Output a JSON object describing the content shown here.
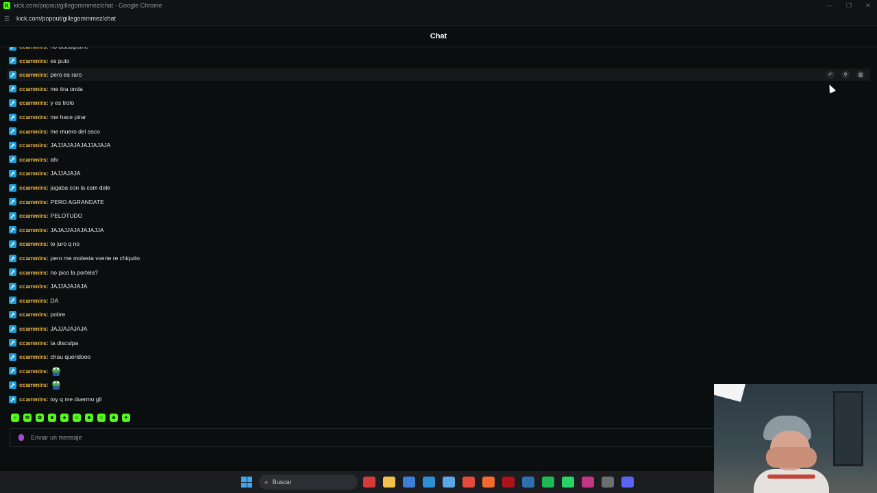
{
  "window": {
    "title": "kick.com/popout/gillegommmez/chat - Google Chrome",
    "url": "kick.com/popout/gillegommmez/chat",
    "controls": [
      "minimize",
      "restore",
      "close"
    ]
  },
  "chat": {
    "header": "Chat",
    "messages": [
      {
        "user": "ccammirs",
        "text": "no disculpame",
        "emote": false
      },
      {
        "user": "ccammirs",
        "text": "es puto",
        "emote": false
      },
      {
        "user": "ccammirs",
        "text": "pero es raro",
        "emote": false
      },
      {
        "user": "ccammirs",
        "text": "me tira onda",
        "emote": false
      },
      {
        "user": "ccammirs",
        "text": "y es trolo",
        "emote": false
      },
      {
        "user": "ccammirs",
        "text": "me hace pirar",
        "emote": false
      },
      {
        "user": "ccammirs",
        "text": "me muero del asco",
        "emote": false
      },
      {
        "user": "ccammirs",
        "text": "JAJJAJAJAJAJJAJAJA",
        "emote": false
      },
      {
        "user": "ccammirs",
        "text": "ahi",
        "emote": false
      },
      {
        "user": "ccammirs",
        "text": "JAJJAJAJA",
        "emote": false
      },
      {
        "user": "ccammirs",
        "text": "jugaba con la cam dale",
        "emote": false
      },
      {
        "user": "ccammirs",
        "text": "PERO AGRANDATE",
        "emote": false
      },
      {
        "user": "ccammirs",
        "text": "PELOTUDO",
        "emote": false
      },
      {
        "user": "ccammirs",
        "text": "JAJAJJAJAJAJAJJA",
        "emote": false
      },
      {
        "user": "ccammirs",
        "text": "te juro q no",
        "emote": false
      },
      {
        "user": "ccammirs",
        "text": "pero me molesta vverte re chiquito",
        "emote": false
      },
      {
        "user": "ccammirs",
        "text": "no pico la portela?",
        "emote": false
      },
      {
        "user": "ccammirs",
        "text": "JAJJAJAJAJA",
        "emote": false
      },
      {
        "user": "ccammirs",
        "text": "DA",
        "emote": false
      },
      {
        "user": "ccammirs",
        "text": "pobre",
        "emote": false
      },
      {
        "user": "ccammirs",
        "text": "JAJJAJAJAJA",
        "emote": false
      },
      {
        "user": "ccammirs",
        "text": "ta disculpa",
        "emote": false
      },
      {
        "user": "ccammirs",
        "text": "chau queridooo",
        "emote": false
      },
      {
        "user": "ccammirs",
        "text": "",
        "emote": true
      },
      {
        "user": "ccammirs",
        "text": "",
        "emote": true
      },
      {
        "user": "ccammirs",
        "text": "toy q me duermo gil",
        "emote": false
      }
    ],
    "hover_actions": [
      "reply-icon",
      "pin-icon",
      "delete-icon"
    ],
    "input_placeholder": "Enviar un mensaje"
  },
  "taskbar": {
    "search_label": "Buscar"
  },
  "colors": {
    "accent": "#53fc18",
    "username": "#f0b93a",
    "badge": "#1e9cd4",
    "background": "#0b0e0f"
  }
}
